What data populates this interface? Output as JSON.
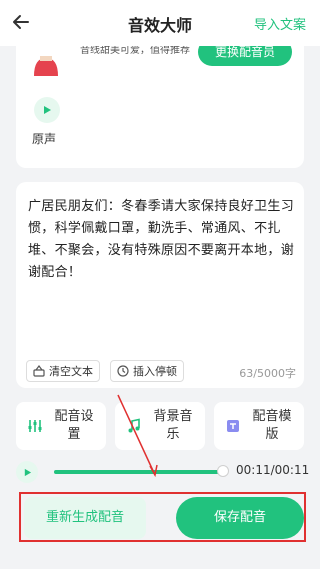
{
  "header": {
    "title": "音效大师",
    "import_label": "导入文案"
  },
  "voice_card": {
    "description": "音线甜美可爱，值得推荐",
    "change_button": "更换配音员",
    "original_label": "原声"
  },
  "editor": {
    "text": "广居民朋友们：冬春季请大家保持良好卫生习惯，科学佩戴口罩，勤洗手、常通风、不扎堆、不聚会，没有特殊原因不要离开本地，谢谢配合！",
    "clear_label": "清空文本",
    "pause_label": "插入停顿",
    "char_count": "63/5000字"
  },
  "options": [
    {
      "label": "配音设置"
    },
    {
      "label": "背景音乐"
    },
    {
      "label": "配音模版"
    }
  ],
  "player": {
    "time": "00:11/00:11",
    "progress": 1.0
  },
  "actions": {
    "regenerate": "重新生成配音",
    "save": "保存配音"
  },
  "colors": {
    "accent": "#21c27e",
    "annotation": "#e03030"
  }
}
